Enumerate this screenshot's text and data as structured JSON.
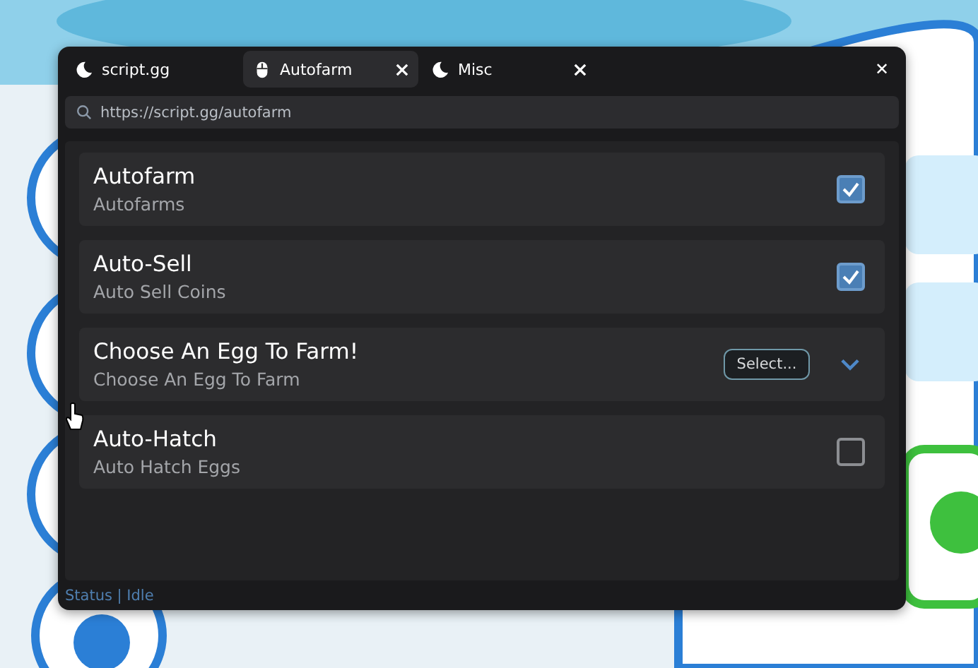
{
  "tabs": [
    {
      "label": "script.gg",
      "closable": false,
      "selected": false
    },
    {
      "label": "Autofarm",
      "closable": true,
      "selected": true
    },
    {
      "label": "Misc",
      "closable": true,
      "selected": false
    }
  ],
  "window_close": "✕",
  "address_bar": {
    "value": "https://script.gg/autofarm"
  },
  "rows": [
    {
      "kind": "toggle",
      "title": "Autofarm",
      "subtitle": "Autofarms",
      "checked": true
    },
    {
      "kind": "toggle",
      "title": "Auto-Sell",
      "subtitle": "Auto Sell Coins",
      "checked": true
    },
    {
      "kind": "dropdown",
      "title": "Choose An Egg To Farm!",
      "subtitle": "Choose An Egg To Farm",
      "button": "Select...",
      "expanded": false
    },
    {
      "kind": "toggle",
      "title": "Auto-Hatch",
      "subtitle": "Auto Hatch Eggs",
      "checked": false
    }
  ],
  "status_bar": "Status | Idle"
}
